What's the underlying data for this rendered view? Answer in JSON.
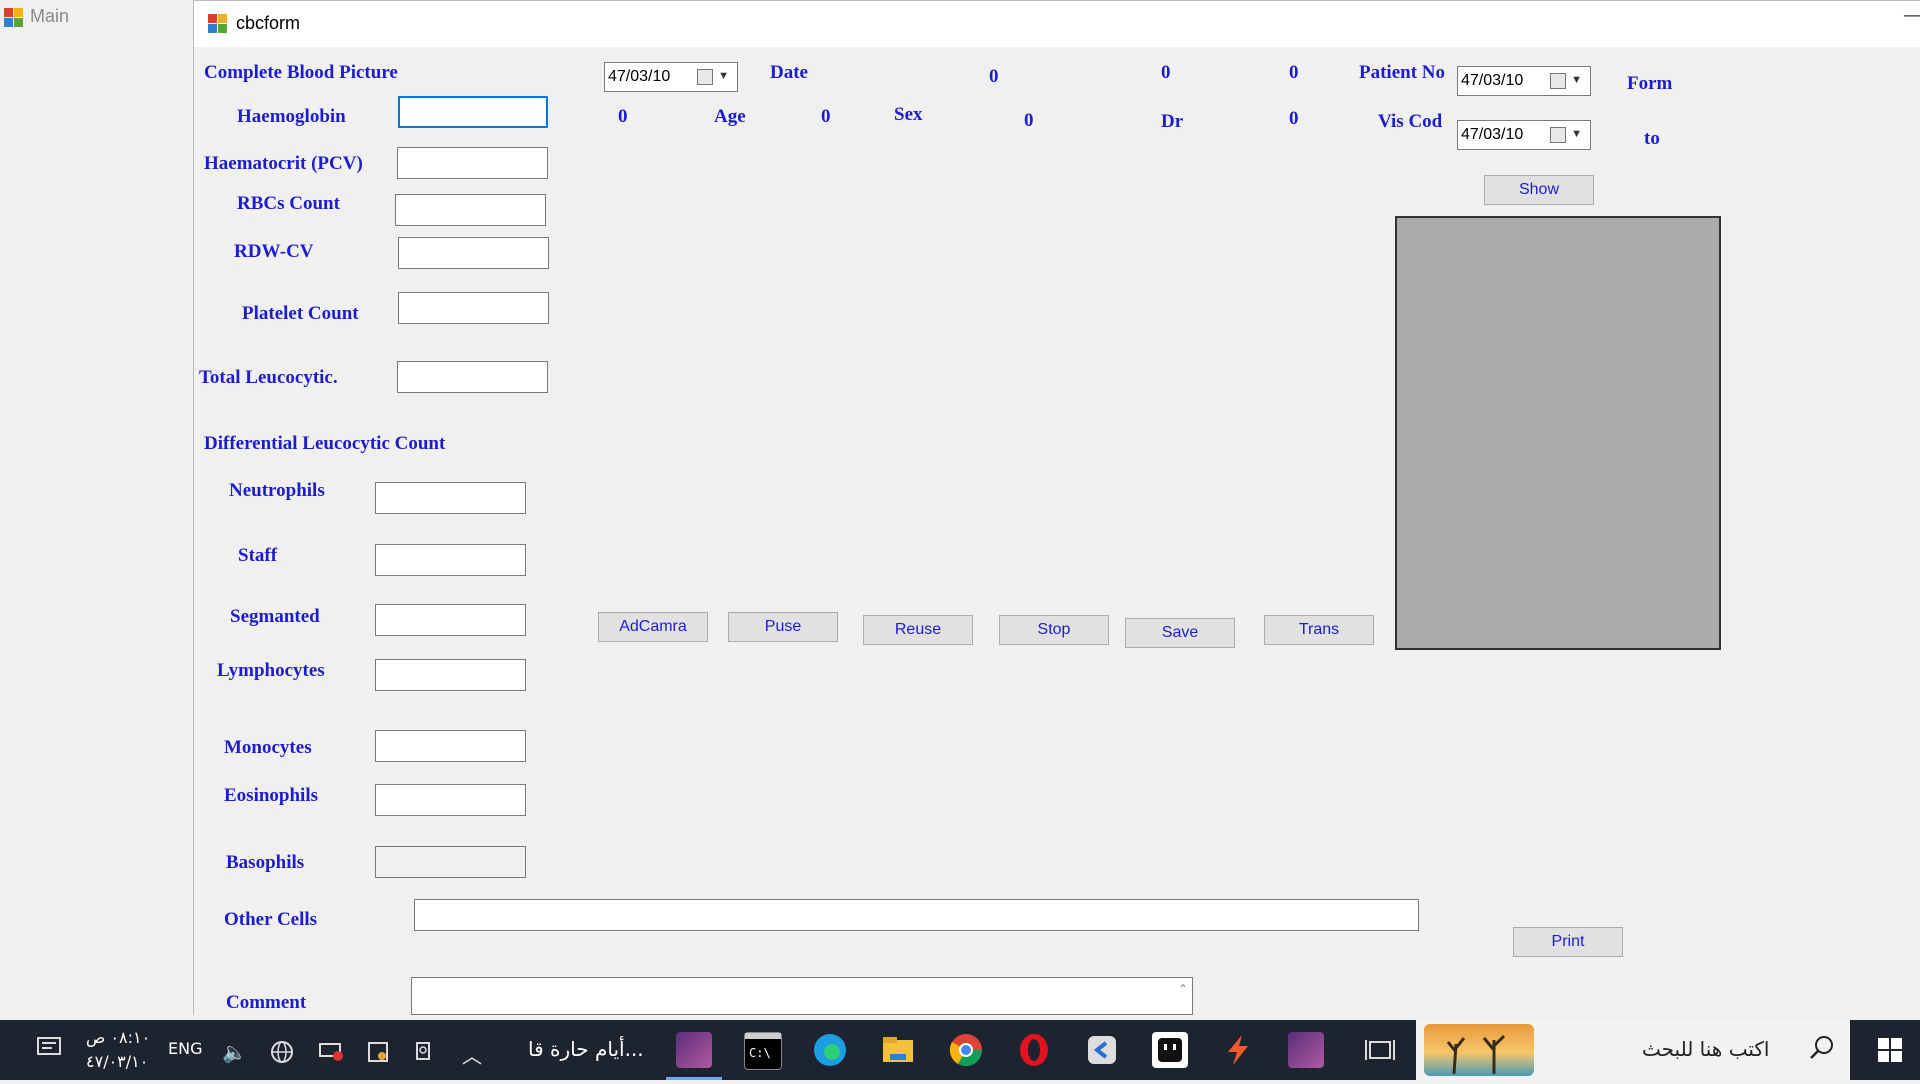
{
  "background_window": {
    "title": "Main"
  },
  "window": {
    "title": "cbcform",
    "minimize_glyph": "—"
  },
  "header": {
    "section_title": "Complete Blood Picture",
    "date_label": "Date",
    "date_picker_value": "47/03/10",
    "patient_no_label": "Patient No",
    "vis_cod_label": "Vis Cod",
    "age_label": "Age",
    "sex_label": "Sex",
    "dr_label": "Dr",
    "form_label": "Form",
    "to_label": "to",
    "from_date_value": "47/03/10",
    "to_date_value": "47/03/10",
    "values": [
      "0",
      "0",
      "0",
      "0",
      "0",
      "0",
      "0",
      "0"
    ]
  },
  "fields": {
    "haemoglobin": "Haemoglobin",
    "haematocrit": "Haematocrit (PCV)",
    "rbcs": "RBCs Count",
    "rdw": "RDW-CV",
    "platelet": "Platelet Count",
    "total_leucocytic": "Total Leucocytic.",
    "differential_title": "Differential Leucocytic Count",
    "neutrophils": "Neutrophils",
    "staff": "Staff",
    "segmanted": "Segmanted",
    "lymphocytes": "Lymphocytes",
    "monocytes": "Monocytes",
    "eosinophils": "Eosinophils",
    "basophils": "Basophils",
    "other_cells": "Other Cells",
    "comment": "Comment"
  },
  "buttons": {
    "show": "Show",
    "adcamra": "AdCamra",
    "puse": "Puse",
    "reuse": "Reuse",
    "stop": "Stop",
    "save": "Save",
    "trans": "Trans",
    "print": "Print"
  },
  "taskbar": {
    "search_placeholder": "اكتب هنا للبحث",
    "running_app_text": "أيام حارة قا...",
    "language": "ENG",
    "time": "٠٨:١٠ ص",
    "date": "٤٧/٠٣/١٠",
    "colors": {
      "bar": "#1d2430",
      "accent": "#6aa7ff"
    },
    "icons": [
      "windows-start-icon",
      "search-icon",
      "widget-icon",
      "task-view-icon",
      "app-tile-icon",
      "maxthon-icon",
      "opera-icon",
      "chrome-icon",
      "file-explorer-icon",
      "edge-icon",
      "terminal-icon",
      "app-tile-icon-2",
      "chevron-up-icon",
      "meet-icon",
      "sync-icon",
      "battery-icon",
      "globe-icon",
      "volume-icon",
      "notification-icon"
    ]
  },
  "colors": {
    "label_blue": "#1d1dd0",
    "focus_border": "#0078d7",
    "picture_box": "#ababab"
  }
}
